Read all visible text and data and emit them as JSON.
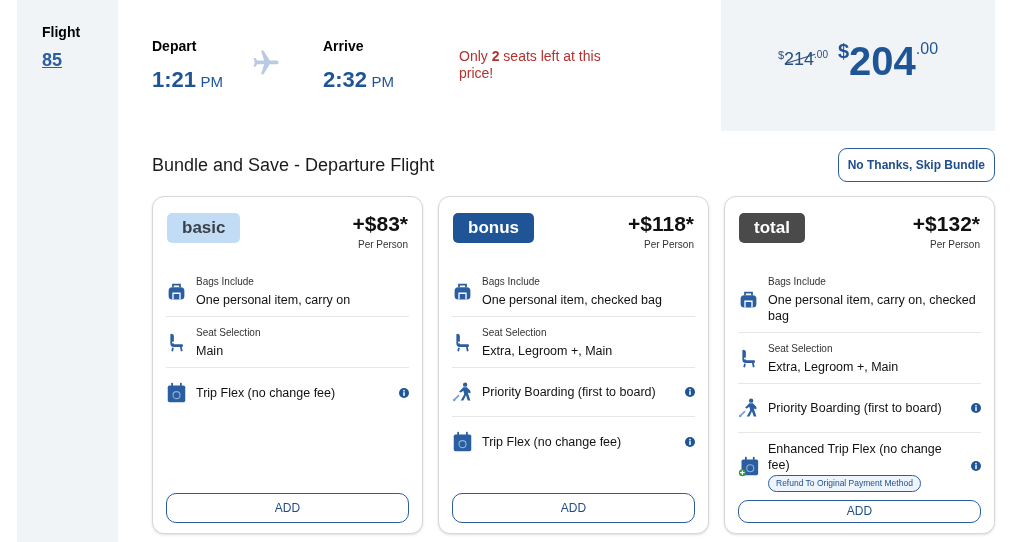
{
  "flight": {
    "label": "Flight",
    "number": "85"
  },
  "depart": {
    "label": "Depart",
    "time": "1:21",
    "period": "PM"
  },
  "arrive": {
    "label": "Arrive",
    "time": "2:32",
    "period": "PM"
  },
  "seats_notice": "Only **2** seats left at this price!",
  "price": {
    "old": {
      "currency": "$",
      "whole": "214",
      "cents": ".00"
    },
    "current": {
      "currency": "$",
      "whole": "204",
      "cents": ".00"
    }
  },
  "bundle": {
    "title": "Bundle and Save - Departure Flight",
    "skip_button": "No Thanks, Skip Bundle"
  },
  "plans": [
    {
      "kind": "basic",
      "name": "basic",
      "price": "+$83*",
      "per": "Per Person",
      "button": "ADD",
      "features": [
        {
          "kind": "bags",
          "label": "Bags Include",
          "value": "One personal item, carry on",
          "info": false
        },
        {
          "kind": "seat",
          "label": "Seat Selection",
          "value": "Main",
          "info": false
        },
        {
          "kind": "flex",
          "value": "Trip Flex (no change fee)",
          "info": true
        }
      ]
    },
    {
      "kind": "bonus",
      "name": "bonus",
      "price": "+$118*",
      "per": "Per Person",
      "button": "ADD",
      "features": [
        {
          "kind": "bags",
          "label": "Bags Include",
          "value": "One personal item, checked bag",
          "info": false
        },
        {
          "kind": "seat",
          "label": "Seat Selection",
          "value": "Extra, Legroom +, Main",
          "info": false
        },
        {
          "kind": "boarding",
          "value": "Priority Boarding (first to board)",
          "info": true
        },
        {
          "kind": "flex",
          "value": "Trip Flex (no change fee)",
          "info": true
        }
      ]
    },
    {
      "kind": "total",
      "name": "total",
      "price": "+$132*",
      "per": "Per Person",
      "button": "ADD",
      "features": [
        {
          "kind": "bags",
          "label": "Bags Include",
          "value": "One personal item, carry on, checked bag",
          "info": false
        },
        {
          "kind": "seat",
          "label": "Seat Selection",
          "value": "Extra, Legroom +, Main",
          "info": false
        },
        {
          "kind": "boarding",
          "value": "Priority Boarding (first to board)",
          "info": true
        },
        {
          "kind": "enhanced_flex",
          "value": "Enhanced Trip Flex (no change fee)",
          "tag": "Refund To Original Payment Method",
          "info": true
        }
      ]
    }
  ]
}
